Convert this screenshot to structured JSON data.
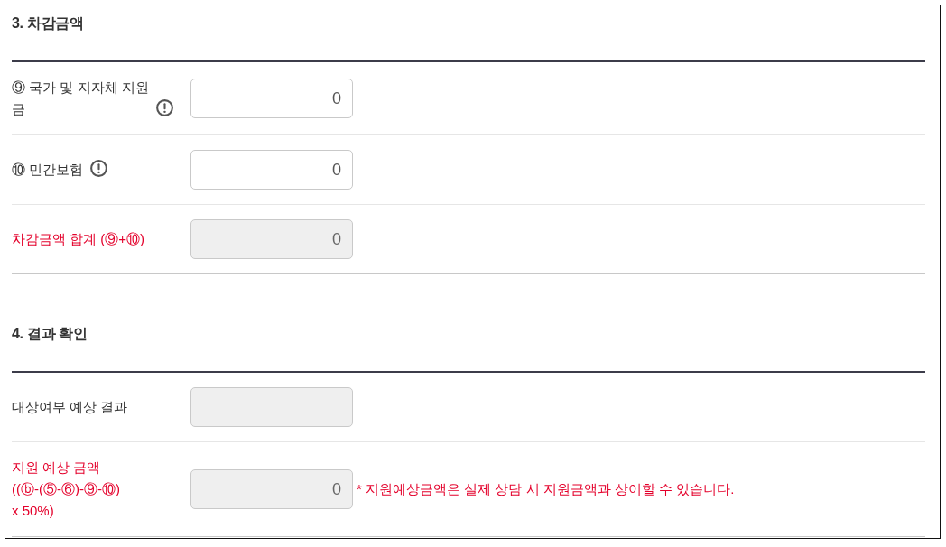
{
  "sections": [
    {
      "title": "3. 차감금액",
      "rows": [
        {
          "label": "⑨ 국가 및 지자체 지원금",
          "info": true,
          "highlighted": false,
          "value": "0",
          "disabled": false
        },
        {
          "label": "⑩ 민간보험",
          "info": true,
          "highlighted": false,
          "value": "0",
          "disabled": false
        },
        {
          "label": "차감금액 합계 (⑨+⑩)",
          "info": false,
          "highlighted": true,
          "value": "0",
          "disabled": true
        }
      ]
    },
    {
      "title": "4. 결과 확인",
      "rows": [
        {
          "label": "대상여부 예상 결과",
          "info": false,
          "highlighted": false,
          "disabled": true
        },
        {
          "label": "지원 예상 금액\n((ⓑ-(⑤-⑥)-⑨-⑩)\nx 50%)",
          "info": false,
          "highlighted": true,
          "value": "0",
          "disabled": true,
          "note": "* 지원예상금액은 실제 상담 시 지원금액과 상이할 수 있습니다."
        }
      ]
    }
  ]
}
